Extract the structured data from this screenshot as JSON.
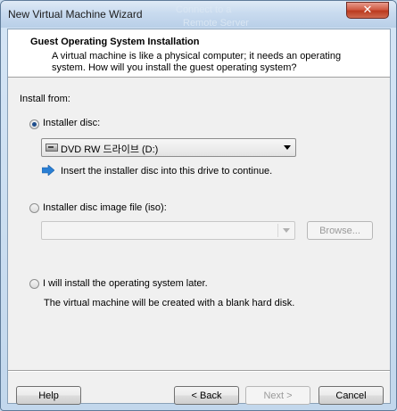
{
  "window": {
    "title": "New Virtual Machine Wizard",
    "background_ghost_text_1": "Connect to a",
    "background_ghost_text_2": "Remote Server",
    "close_label": "✕"
  },
  "header": {
    "title": "Guest Operating System Installation",
    "description": "A virtual machine is like a physical computer; it needs an operating system. How will you install the guest operating system?"
  },
  "install_from": {
    "label": "Install from:",
    "installer_disc": {
      "label": "Installer disc:",
      "selected": true,
      "drive_value": "DVD RW 드라이브 (D:)",
      "hint": "Insert the installer disc into this drive to continue."
    },
    "disc_image": {
      "label": "Installer disc image file (iso):",
      "selected": false,
      "path_value": "",
      "browse_label": "Browse..."
    },
    "later": {
      "label": "I will install the operating system later.",
      "selected": false,
      "note": "The virtual machine will be created with a blank hard disk."
    }
  },
  "footer": {
    "help": "Help",
    "back": "< Back",
    "next": "Next >",
    "cancel": "Cancel"
  },
  "colors": {
    "accent": "#1f4e8c",
    "info_arrow": "#2a7fd4"
  }
}
